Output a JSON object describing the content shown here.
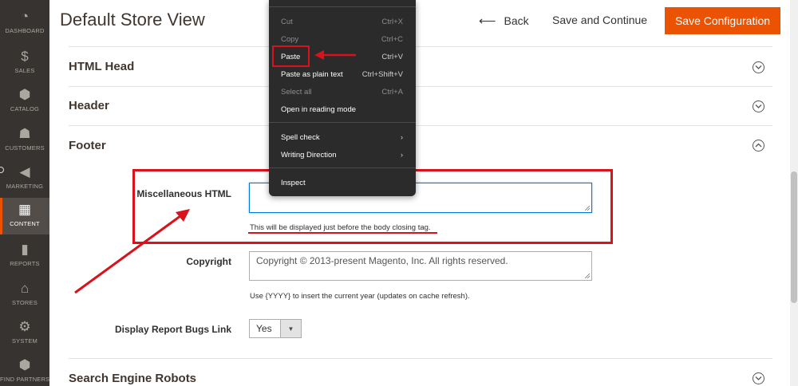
{
  "menu": {
    "items": [
      {
        "label": "DASHBOARD",
        "icon": "dashboard-icon",
        "glyph": "◔"
      },
      {
        "label": "SALES",
        "icon": "dollar-icon",
        "glyph": "$"
      },
      {
        "label": "CATALOG",
        "icon": "cube-icon",
        "glyph": "⬢"
      },
      {
        "label": "CUSTOMERS",
        "icon": "person-icon",
        "glyph": "☗"
      },
      {
        "label": "MARKETING",
        "icon": "megaphone-icon",
        "glyph": "◀"
      },
      {
        "label": "CONTENT",
        "icon": "layout-icon",
        "glyph": "▦"
      },
      {
        "label": "REPORTS",
        "icon": "bar-chart-icon",
        "glyph": "▮"
      },
      {
        "label": "STORES",
        "icon": "storefront-icon",
        "glyph": "⌂"
      },
      {
        "label": "SYSTEM",
        "icon": "gear-icon",
        "glyph": "⚙"
      },
      {
        "label": "FIND PARTNERS",
        "icon": "box-icon",
        "glyph": "⬢"
      }
    ]
  },
  "header": {
    "title": "Default Store View",
    "back_label": "Back",
    "save_continue_label": "Save and Continue",
    "save_config_label": "Save Configuration"
  },
  "sections": {
    "html_head": "HTML Head",
    "header": "Header",
    "footer": "Footer",
    "search_engine_robots": "Search Engine Robots"
  },
  "footer_form": {
    "misc_html_label": "Miscellaneous HTML",
    "misc_html_value": "",
    "misc_html_note": "This will be displayed just before the body closing tag.",
    "copyright_label": "Copyright",
    "copyright_value": "Copyright © 2013-present Magento, Inc. All rights reserved.",
    "copyright_note": "Use {YYYY} to insert the current year (updates on cache refresh).",
    "report_bugs_label": "Display Report Bugs Link",
    "report_bugs_value": "Yes"
  },
  "context_menu": {
    "items": [
      {
        "label": "Cut",
        "shortcut": "Ctrl+X"
      },
      {
        "label": "Copy",
        "shortcut": "Ctrl+C"
      },
      {
        "label": "Paste",
        "shortcut": "Ctrl+V"
      },
      {
        "label": "Paste as plain text",
        "shortcut": "Ctrl+Shift+V"
      },
      {
        "label": "Select all",
        "shortcut": "Ctrl+A"
      },
      {
        "label": "Open in reading mode",
        "shortcut": ""
      },
      {
        "label": "Spell check",
        "shortcut": "›"
      },
      {
        "label": "Writing Direction",
        "shortcut": "›"
      },
      {
        "label": "Inspect",
        "shortcut": ""
      }
    ]
  },
  "colors": {
    "accent": "#eb5202",
    "menu_bg": "#373330",
    "annotation_red": "#d9121b",
    "context_menu_bg": "#2b2b2b"
  }
}
